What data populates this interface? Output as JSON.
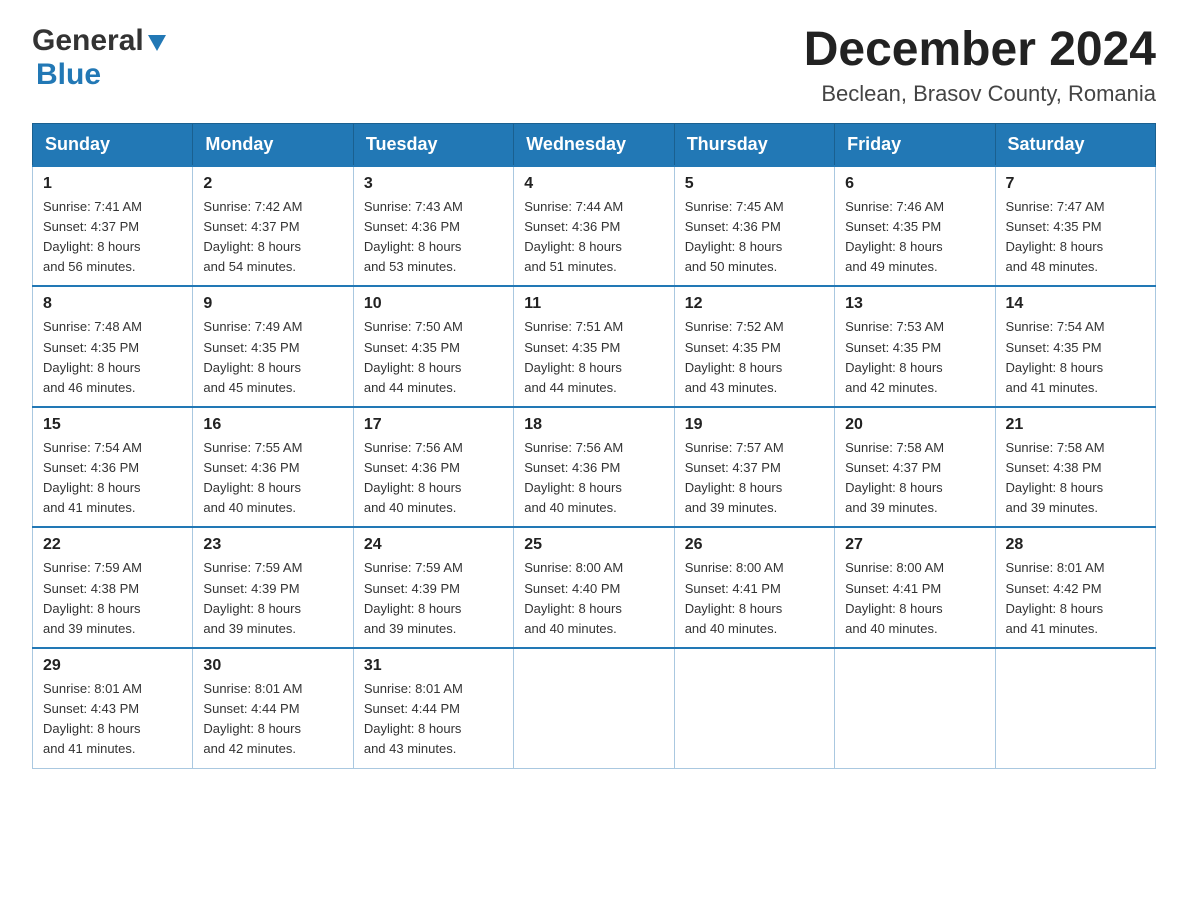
{
  "header": {
    "logo_general": "General",
    "logo_blue": "Blue",
    "title": "December 2024",
    "subtitle": "Beclean, Brasov County, Romania"
  },
  "days_of_week": [
    "Sunday",
    "Monday",
    "Tuesday",
    "Wednesday",
    "Thursday",
    "Friday",
    "Saturday"
  ],
  "weeks": [
    [
      {
        "day": 1,
        "sunrise": "7:41 AM",
        "sunset": "4:37 PM",
        "daylight": "8 hours and 56 minutes."
      },
      {
        "day": 2,
        "sunrise": "7:42 AM",
        "sunset": "4:37 PM",
        "daylight": "8 hours and 54 minutes."
      },
      {
        "day": 3,
        "sunrise": "7:43 AM",
        "sunset": "4:36 PM",
        "daylight": "8 hours and 53 minutes."
      },
      {
        "day": 4,
        "sunrise": "7:44 AM",
        "sunset": "4:36 PM",
        "daylight": "8 hours and 51 minutes."
      },
      {
        "day": 5,
        "sunrise": "7:45 AM",
        "sunset": "4:36 PM",
        "daylight": "8 hours and 50 minutes."
      },
      {
        "day": 6,
        "sunrise": "7:46 AM",
        "sunset": "4:35 PM",
        "daylight": "8 hours and 49 minutes."
      },
      {
        "day": 7,
        "sunrise": "7:47 AM",
        "sunset": "4:35 PM",
        "daylight": "8 hours and 48 minutes."
      }
    ],
    [
      {
        "day": 8,
        "sunrise": "7:48 AM",
        "sunset": "4:35 PM",
        "daylight": "8 hours and 46 minutes."
      },
      {
        "day": 9,
        "sunrise": "7:49 AM",
        "sunset": "4:35 PM",
        "daylight": "8 hours and 45 minutes."
      },
      {
        "day": 10,
        "sunrise": "7:50 AM",
        "sunset": "4:35 PM",
        "daylight": "8 hours and 44 minutes."
      },
      {
        "day": 11,
        "sunrise": "7:51 AM",
        "sunset": "4:35 PM",
        "daylight": "8 hours and 44 minutes."
      },
      {
        "day": 12,
        "sunrise": "7:52 AM",
        "sunset": "4:35 PM",
        "daylight": "8 hours and 43 minutes."
      },
      {
        "day": 13,
        "sunrise": "7:53 AM",
        "sunset": "4:35 PM",
        "daylight": "8 hours and 42 minutes."
      },
      {
        "day": 14,
        "sunrise": "7:54 AM",
        "sunset": "4:35 PM",
        "daylight": "8 hours and 41 minutes."
      }
    ],
    [
      {
        "day": 15,
        "sunrise": "7:54 AM",
        "sunset": "4:36 PM",
        "daylight": "8 hours and 41 minutes."
      },
      {
        "day": 16,
        "sunrise": "7:55 AM",
        "sunset": "4:36 PM",
        "daylight": "8 hours and 40 minutes."
      },
      {
        "day": 17,
        "sunrise": "7:56 AM",
        "sunset": "4:36 PM",
        "daylight": "8 hours and 40 minutes."
      },
      {
        "day": 18,
        "sunrise": "7:56 AM",
        "sunset": "4:36 PM",
        "daylight": "8 hours and 40 minutes."
      },
      {
        "day": 19,
        "sunrise": "7:57 AM",
        "sunset": "4:37 PM",
        "daylight": "8 hours and 39 minutes."
      },
      {
        "day": 20,
        "sunrise": "7:58 AM",
        "sunset": "4:37 PM",
        "daylight": "8 hours and 39 minutes."
      },
      {
        "day": 21,
        "sunrise": "7:58 AM",
        "sunset": "4:38 PM",
        "daylight": "8 hours and 39 minutes."
      }
    ],
    [
      {
        "day": 22,
        "sunrise": "7:59 AM",
        "sunset": "4:38 PM",
        "daylight": "8 hours and 39 minutes."
      },
      {
        "day": 23,
        "sunrise": "7:59 AM",
        "sunset": "4:39 PM",
        "daylight": "8 hours and 39 minutes."
      },
      {
        "day": 24,
        "sunrise": "7:59 AM",
        "sunset": "4:39 PM",
        "daylight": "8 hours and 39 minutes."
      },
      {
        "day": 25,
        "sunrise": "8:00 AM",
        "sunset": "4:40 PM",
        "daylight": "8 hours and 40 minutes."
      },
      {
        "day": 26,
        "sunrise": "8:00 AM",
        "sunset": "4:41 PM",
        "daylight": "8 hours and 40 minutes."
      },
      {
        "day": 27,
        "sunrise": "8:00 AM",
        "sunset": "4:41 PM",
        "daylight": "8 hours and 40 minutes."
      },
      {
        "day": 28,
        "sunrise": "8:01 AM",
        "sunset": "4:42 PM",
        "daylight": "8 hours and 41 minutes."
      }
    ],
    [
      {
        "day": 29,
        "sunrise": "8:01 AM",
        "sunset": "4:43 PM",
        "daylight": "8 hours and 41 minutes."
      },
      {
        "day": 30,
        "sunrise": "8:01 AM",
        "sunset": "4:44 PM",
        "daylight": "8 hours and 42 minutes."
      },
      {
        "day": 31,
        "sunrise": "8:01 AM",
        "sunset": "4:44 PM",
        "daylight": "8 hours and 43 minutes."
      },
      null,
      null,
      null,
      null
    ]
  ],
  "labels": {
    "sunrise": "Sunrise:",
    "sunset": "Sunset:",
    "daylight": "Daylight:"
  }
}
